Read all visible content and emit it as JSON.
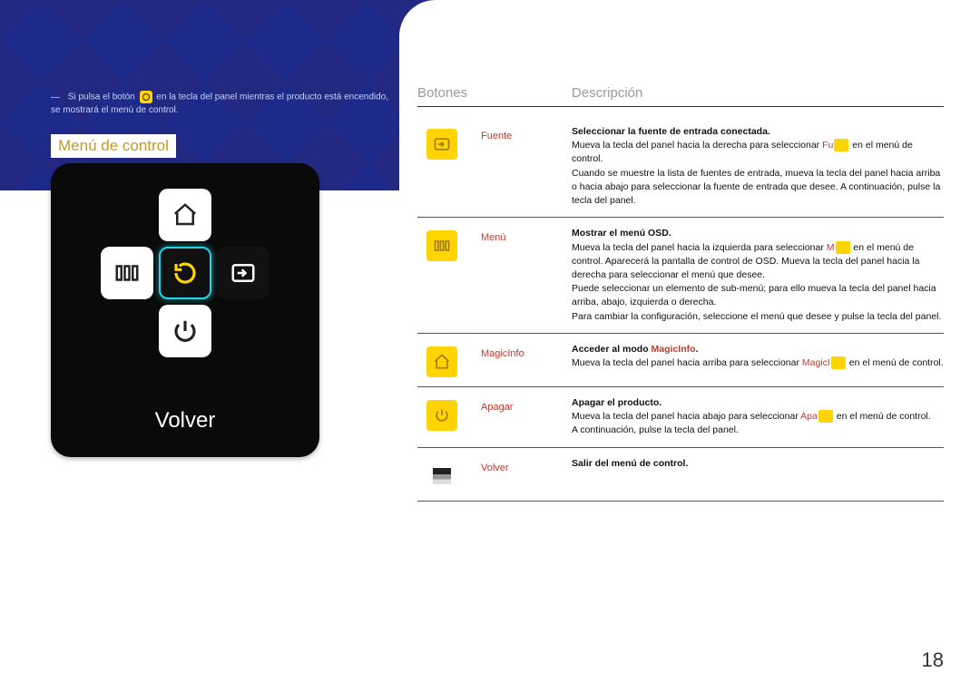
{
  "note_pre": "Si pulsa el botón",
  "note_post": "en la tecla del panel mientras el producto está encendido, se mostrará el menú de control.",
  "section_title": "Menú de control",
  "volver": "Volver",
  "table": {
    "head_buttons": "Botones",
    "head_desc": "Descripción"
  },
  "rows": {
    "fuente": {
      "label": "Fuente",
      "title": "Seleccionar la fuente de entrada conectada.",
      "p1a": "Mueva la tecla del panel hacia la derecha para seleccionar ",
      "hl1": "Fu",
      "p1b": " en el menú de control.",
      "p2": "Cuando se muestre la lista de fuentes de entrada, mueva la tecla del panel hacia arriba o hacia abajo para seleccionar la fuente de entrada que desee. A continuación, pulse la tecla del panel."
    },
    "menu": {
      "label": "Menú",
      "title": "Mostrar el menú OSD.",
      "p1a": "Mueva la tecla del panel hacia la izquierda para seleccionar ",
      "hl1": "M",
      "p1b": " en el menú de control. Aparecerá la pantalla de control de OSD. Mueva la tecla del panel hacia la derecha para seleccionar el menú que desee.",
      "p2": "Puede seleccionar un elemento de sub-menú; para ello mueva la tecla del panel hacia arriba, abajo, izquierda o derecha.",
      "p3": "Para cambiar la configuración, seleccione el menú que desee y pulse la tecla del panel."
    },
    "magic": {
      "label": "MagicInfo",
      "title_pre": "Acceder al modo ",
      "title_hl": "MagicInfo",
      "title_post": ".",
      "p1a": "Mueva la tecla del panel hacia arriba para seleccionar ",
      "hl1": "MagicI",
      "p1b": " en el menú de control."
    },
    "apagar": {
      "label": "Apagar",
      "title": "Apagar el producto.",
      "p1a": "Mueva la tecla del panel hacia abajo para seleccionar ",
      "hl1": "Apa",
      "p1b": " en el menú de control.",
      "p2": "A continuación, pulse la tecla del panel."
    },
    "volver": {
      "label": "Volver",
      "title": "Salir del menú de control."
    }
  },
  "page_number": "18"
}
